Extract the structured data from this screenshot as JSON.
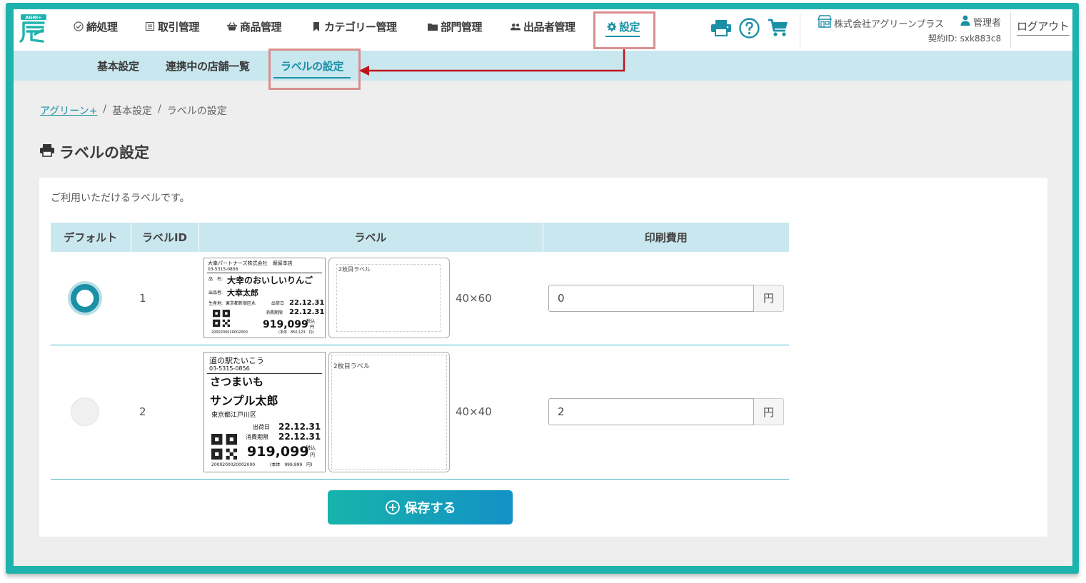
{
  "nav": {
    "items": [
      {
        "key": "closing",
        "label": "締処理",
        "icon": "check-circle-icon"
      },
      {
        "key": "transactions",
        "label": "取引管理",
        "icon": "document-icon"
      },
      {
        "key": "products",
        "label": "商品管理",
        "icon": "basket-icon"
      },
      {
        "key": "categories",
        "label": "カテゴリー管理",
        "icon": "bookmark-icon"
      },
      {
        "key": "departments",
        "label": "部門管理",
        "icon": "folder-icon"
      },
      {
        "key": "sellers",
        "label": "出品者管理",
        "icon": "users-icon"
      },
      {
        "key": "settings",
        "label": "設定",
        "icon": "gear-icon",
        "active": true
      }
    ],
    "logo_text": "AGRI+",
    "company": "株式会社アグリーンプラス",
    "user_role": "管理者",
    "contract_id": "契約ID: sxk883c8",
    "logout": "ログアウト"
  },
  "subnav": {
    "items": [
      {
        "label": "基本設定"
      },
      {
        "label": "連携中の店舗一覧"
      },
      {
        "label": "ラベルの設定",
        "active": true
      }
    ]
  },
  "breadcrumb": {
    "home": "アグリーン+",
    "sep": "/",
    "level1": "基本設定",
    "current": "ラベルの設定"
  },
  "page": {
    "title": "ラベルの設定",
    "intro": "ご利用いただけるラベルです。",
    "save_label": "保存する"
  },
  "table": {
    "headers": {
      "default": "デフォルト",
      "label_id": "ラベルID",
      "label": "ラベル",
      "print_cost": "印刷費用"
    },
    "currency": "円",
    "rows": [
      {
        "selected": true,
        "id": "1",
        "size": "40×60",
        "cost": "0",
        "preview": {
          "store": "大幸パートナーズ株式会社　堀留本店",
          "phone": "03-5315-0856",
          "name_label": "品　名:",
          "product": "大幸のおいしいりんご",
          "seller_label": "出品者:",
          "seller": "大幸太郎",
          "origin_label": "生産地:",
          "origin": "東京都新宿区永",
          "ship_label": "出荷日",
          "ship_date": "22.12.31",
          "expiry_label": "消費期限",
          "expiry_date": "22.12.31",
          "price": "919,099",
          "tax": "税込",
          "yen": "円",
          "base": "(本体　850,123　円)",
          "barcode": "2000200020002000",
          "second_caption": "2枚目ラベル"
        }
      },
      {
        "selected": false,
        "id": "2",
        "size": "40×40",
        "cost": "2",
        "preview": {
          "store": "道の駅たいこう",
          "phone": "03-5315-0856",
          "product": "さつまいも",
          "seller": "サンプル太郎",
          "origin": "東京都江戸川区",
          "ship_label": "出荷日",
          "ship_date": "22.12.31",
          "expiry_label": "消費期限",
          "expiry_date": "22.12.31",
          "price": "919,099",
          "tax": "税込",
          "yen": "円",
          "base": "(本体　999,999　円)",
          "barcode": "2000200020002000",
          "second_caption": "2枚目ラベル"
        }
      }
    ]
  },
  "colors": {
    "frame": "#1fb3ad",
    "accent": "#1a8fa6",
    "subnav_bg": "#c9e7ee",
    "highlight": "#d98f8f",
    "arrow": "#c0141c"
  }
}
